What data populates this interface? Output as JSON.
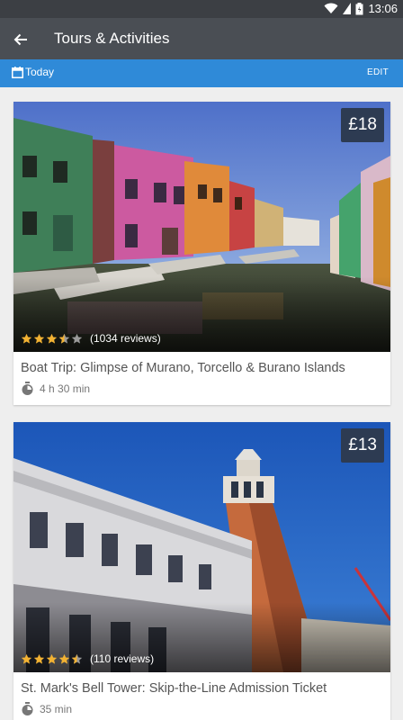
{
  "status_bar": {
    "time": "13:06"
  },
  "app_bar": {
    "title": "Tours & Activities"
  },
  "date_bar": {
    "label": "Today",
    "edit_label": "EDIT"
  },
  "colors": {
    "app_bar": "#4a4e54",
    "accent": "#2f8ad8",
    "price_badge": "#2d3b52",
    "star": "#f2b233"
  },
  "icons": {
    "back": "arrow-left-icon",
    "date": "calendar-icon",
    "duration": "stopwatch-icon",
    "rating": "star-icon"
  },
  "tours": [
    {
      "price": "£18",
      "rating": 3.5,
      "reviews": "(1034 reviews)",
      "title": "Boat Trip: Glimpse of Murano, Torcello & Burano Islands",
      "duration": "4 h 30 min"
    },
    {
      "price": "£13",
      "rating": 4.5,
      "reviews": "(110 reviews)",
      "title": "St. Mark's Bell Tower: Skip-the-Line Admission Ticket",
      "duration": "35 min"
    }
  ]
}
